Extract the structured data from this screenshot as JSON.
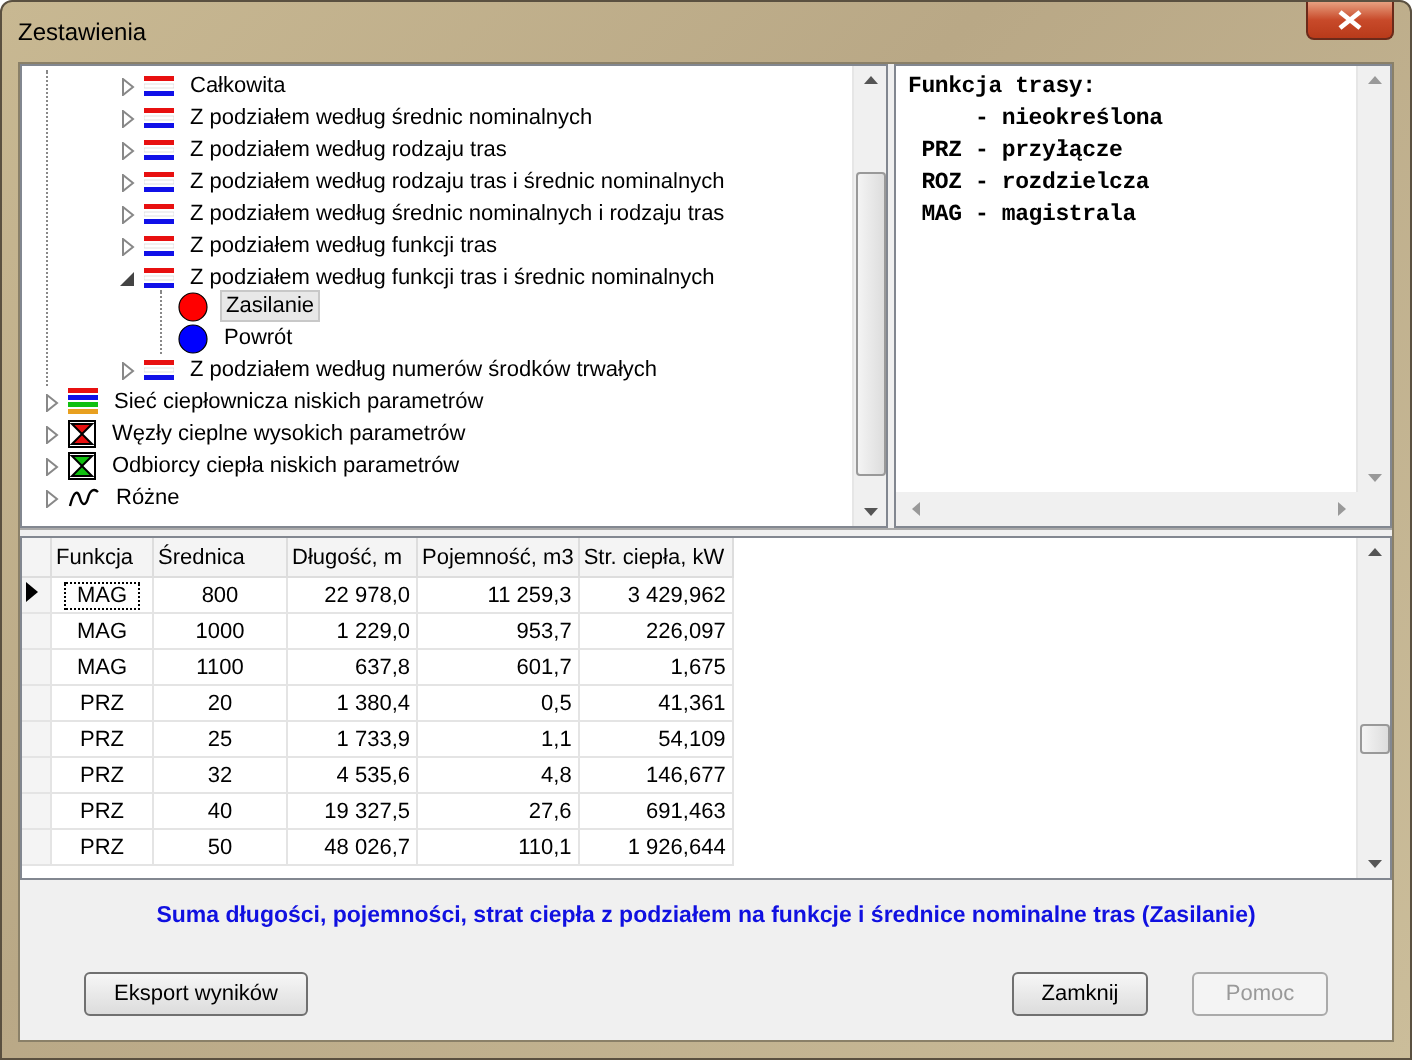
{
  "window": {
    "title": "Zestawienia"
  },
  "tree": {
    "continued_items": [
      {
        "label": "Całkowita",
        "expanded": false
      },
      {
        "label": "Z podziałem według średnic nominalnych",
        "expanded": false
      },
      {
        "label": "Z podziałem według rodzaju tras",
        "expanded": false
      },
      {
        "label": "Z podziałem według rodzaju tras i średnic nominalnych",
        "expanded": false
      },
      {
        "label": "Z podziałem według średnic nominalnych i rodzaju tras",
        "expanded": false
      },
      {
        "label": "Z podziałem według funkcji tras",
        "expanded": false
      },
      {
        "label": "Z podziałem według funkcji tras i średnic nominalnych",
        "expanded": true,
        "children": [
          {
            "label": "Zasilanie",
            "color": "#ff0000",
            "selected": true
          },
          {
            "label": "Powrót",
            "color": "#0000ff",
            "selected": false
          }
        ]
      },
      {
        "label": "Z podziałem według numerów środków trwałych",
        "expanded": false
      }
    ],
    "items": [
      {
        "label": "Sieć ciepłownicza niskich parametrów",
        "kind": "network",
        "expanded": false
      },
      {
        "label": "Węzły cieplne wysokich parametrów",
        "kind": "node_red",
        "expanded": false
      },
      {
        "label": "Odbiorcy ciepła niskich parametrów",
        "kind": "node_green",
        "expanded": false
      },
      {
        "label": "Różne",
        "kind": "wave",
        "expanded": false
      }
    ]
  },
  "legend": {
    "lines": [
      "Funkcja trasy:",
      "     - nieokreślona",
      " PRZ - przyłącze",
      " ROZ - rozdzielcza",
      " MAG - magistrala"
    ]
  },
  "table": {
    "columns": [
      "Funkcja",
      "Średnica",
      "Długość, m",
      "Pojemność, m3",
      "Str. ciepła, kW"
    ],
    "rows": [
      {
        "cells": [
          "MAG",
          "800",
          "22 978,0",
          "11 259,3",
          "3 429,962"
        ],
        "selected": true
      },
      {
        "cells": [
          "MAG",
          "1000",
          "1 229,0",
          "953,7",
          "226,097"
        ],
        "selected": false
      },
      {
        "cells": [
          "MAG",
          "1100",
          "637,8",
          "601,7",
          "1,675"
        ],
        "selected": false
      },
      {
        "cells": [
          "PRZ",
          "20",
          "1 380,4",
          "0,5",
          "41,361"
        ],
        "selected": false
      },
      {
        "cells": [
          "PRZ",
          "25",
          "1 733,9",
          "1,1",
          "54,109"
        ],
        "selected": false
      },
      {
        "cells": [
          "PRZ",
          "32",
          "4 535,6",
          "4,8",
          "146,677"
        ],
        "selected": false
      },
      {
        "cells": [
          "PRZ",
          "40",
          "19 327,5",
          "27,6",
          "691,463"
        ],
        "selected": false
      },
      {
        "cells": [
          "PRZ",
          "50",
          "48 026,7",
          "110,1",
          "1 926,644"
        ],
        "selected": false
      }
    ]
  },
  "summary": "Suma długości, pojemności, strat ciepła z podziałem na funkcje i średnice nominalne tras (Zasilanie)",
  "buttons": [
    {
      "label": "Eksport wyników",
      "disabled": false
    },
    {
      "label": "Zamknij",
      "disabled": false
    },
    {
      "label": "Pomoc",
      "disabled": true
    }
  ]
}
